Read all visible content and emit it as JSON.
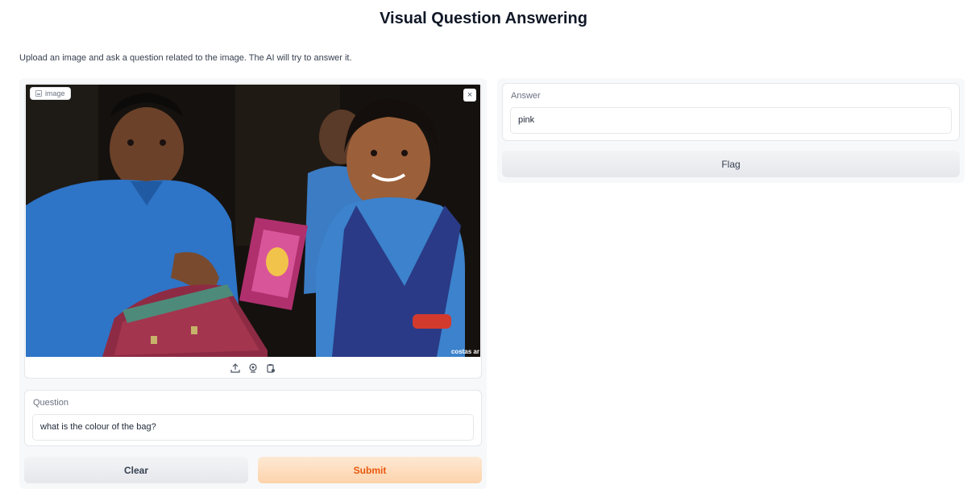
{
  "page": {
    "title": "Visual Question Answering",
    "description": "Upload an image and ask a question related to the image. The AI will try to answer it."
  },
  "image_input": {
    "label": "image",
    "label_icon": "image-icon",
    "close_icon": "close-icon",
    "close_glyph": "×",
    "watermark": "costas ar",
    "toolbar_icons": [
      "upload-icon",
      "webcam-icon",
      "clipboard-icon"
    ]
  },
  "question": {
    "label": "Question",
    "value": "what is the colour of the bag?"
  },
  "buttons": {
    "clear": "Clear",
    "submit": "Submit",
    "flag": "Flag"
  },
  "answer": {
    "label": "Answer",
    "value": "pink"
  },
  "colors": {
    "submit_text": "#ea580c",
    "submit_bg": "#fdd3ab",
    "panel_bg": "#f7f8fa"
  }
}
